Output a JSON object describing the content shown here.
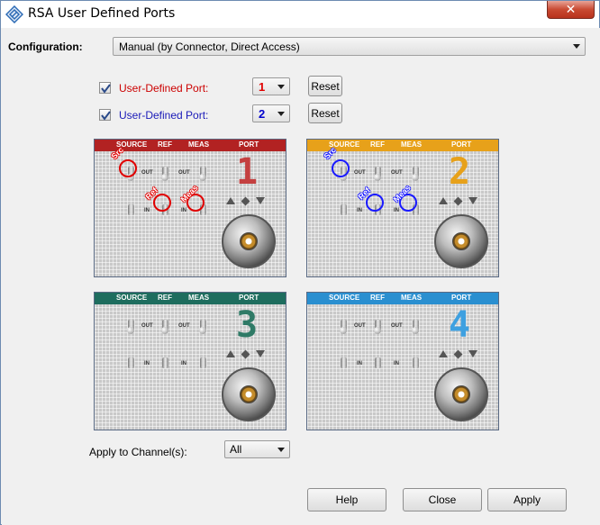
{
  "window": {
    "title": "RSA User Defined Ports",
    "close_label": "✕"
  },
  "config": {
    "label": "Configuration:",
    "value": "Manual (by Connector, Direct Access)"
  },
  "user_ports": [
    {
      "label": "User-Defined Port:",
      "value": "1",
      "reset_label": "Reset",
      "color": "#e00000",
      "checked": true
    },
    {
      "label": "User-Defined Port:",
      "value": "2",
      "reset_label": "Reset",
      "color": "#0000cc",
      "checked": true
    }
  ],
  "panels": [
    {
      "num": "1",
      "header_color": "#b22222",
      "num_color": "#c44040",
      "headers": {
        "source": "SOURCE",
        "ref": "REF",
        "meas": "MEAS",
        "port": "PORT"
      },
      "out_label": "OUT",
      "in_label": "IN",
      "markers": {
        "src": "Src",
        "ref": "Ref",
        "meas": "Meas",
        "color": "#e00000"
      }
    },
    {
      "num": "2",
      "header_color": "#e7a11a",
      "num_color": "#e7a11a",
      "headers": {
        "source": "SOURCE",
        "ref": "REF",
        "meas": "MEAS",
        "port": "PORT"
      },
      "out_label": "OUT",
      "in_label": "IN",
      "markers": {
        "src": "Src",
        "ref": "Ref",
        "meas": "Meas",
        "color": "#1a1aff"
      }
    },
    {
      "num": "3",
      "header_color": "#1e6d5e",
      "num_color": "#2f7a66",
      "headers": {
        "source": "SOURCE",
        "ref": "REF",
        "meas": "MEAS",
        "port": "PORT"
      },
      "out_label": "OUT",
      "in_label": "IN"
    },
    {
      "num": "4",
      "header_color": "#2a8fd0",
      "num_color": "#3ea0e0",
      "headers": {
        "source": "SOURCE",
        "ref": "REF",
        "meas": "MEAS",
        "port": "PORT"
      },
      "out_label": "OUT",
      "in_label": "IN"
    }
  ],
  "apply_channels": {
    "label": "Apply to Channel(s):",
    "value": "All"
  },
  "buttons": {
    "help": "Help",
    "close": "Close",
    "apply": "Apply"
  }
}
